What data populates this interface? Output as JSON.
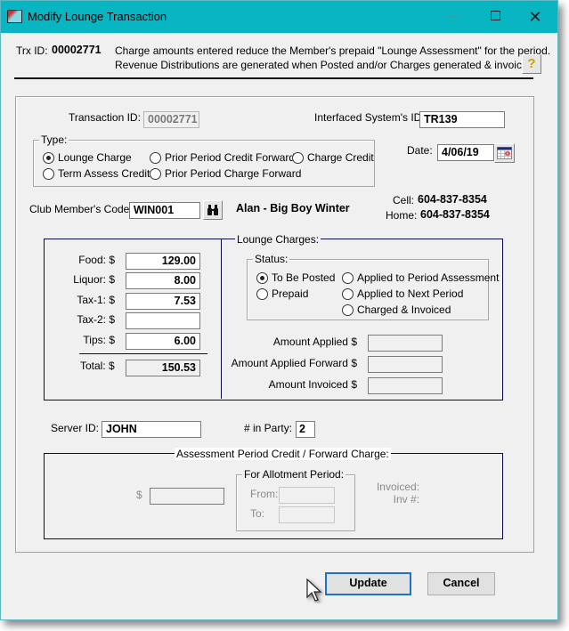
{
  "window": {
    "title": "Modify Lounge Transaction",
    "controls": {
      "minimize": "—",
      "maximize": "□",
      "close": "✕"
    }
  },
  "header": {
    "trx_label": "Trx ID:",
    "trx_value": "00002771",
    "message_line1": "Charge amounts entered reduce the  Member's prepaid \"Lounge Assessment\" for the period.",
    "message_line2": "Revenue Distributions are generated when Posted and/or Charges generated & invoiced.",
    "help_icon": "help-question-icon",
    "help_glyph": "?"
  },
  "transaction": {
    "id_label": "Transaction ID:",
    "id_value": "00002771",
    "interfaced_label": "Interfaced System's ID:",
    "interfaced_value": "TR139",
    "date_label": "Date:",
    "date_value": "4/06/19",
    "calendar_icon": "calendar-icon"
  },
  "type": {
    "legend": "Type:",
    "options": [
      {
        "label": "Lounge Charge",
        "selected": true
      },
      {
        "label": "Prior Period Credit Forward",
        "selected": false
      },
      {
        "label": "Charge Credit",
        "selected": false
      },
      {
        "label": "Term Assess Credit",
        "selected": false
      },
      {
        "label": "Prior Period Charge Forward",
        "selected": false
      }
    ]
  },
  "member": {
    "code_label": "Club Member's Code:",
    "code_value": "WIN001",
    "lookup_icon": "binoculars-icon",
    "name": "Alan - Big Boy  Winter",
    "cell_label": "Cell:",
    "cell_value": "604-837-8354",
    "home_label": "Home:",
    "home_value": "604-837-8354"
  },
  "charges": {
    "legend": "Lounge Charges:",
    "items": [
      {
        "label": "Food:  $",
        "value": "129.00"
      },
      {
        "label": "Liquor:  $",
        "value": "8.00"
      },
      {
        "label": "Tax-1:  $",
        "value": "7.53"
      },
      {
        "label": "Tax-2:  $",
        "value": ""
      },
      {
        "label": "Tips:  $",
        "value": "6.00"
      }
    ],
    "total_label": "Total:  $",
    "total_value": "150.53"
  },
  "status": {
    "legend": "Status:",
    "options": [
      {
        "label": "To Be Posted",
        "selected": true
      },
      {
        "label": "Applied to Period Assessment",
        "selected": false
      },
      {
        "label": "Prepaid",
        "selected": false
      },
      {
        "label": "Applied to Next Period",
        "selected": false
      },
      {
        "label": "Charged & Invoiced",
        "selected": false
      }
    ]
  },
  "amounts": {
    "applied_label": "Amount Applied  $",
    "applied_value": "",
    "applied_forward_label": "Amount Applied Forward  $",
    "applied_forward_value": "",
    "invoiced_label": "Amount Invoiced  $",
    "invoiced_value": ""
  },
  "server": {
    "id_label": "Server ID:",
    "id_value": "JOHN",
    "party_label": "# in Party:",
    "party_value": "2"
  },
  "assessment": {
    "legend": "Assessment Period Credit / Forward Charge:",
    "dollar_label": "$",
    "amount_value": "",
    "allotment_legend": "For Allotment Period:",
    "from_label": "From:",
    "from_value": "",
    "to_label": "To:",
    "to_value": "",
    "invoiced_label": "Invoiced:",
    "inv_label": "Inv #:"
  },
  "buttons": {
    "update": "Update",
    "cancel": "Cancel"
  }
}
